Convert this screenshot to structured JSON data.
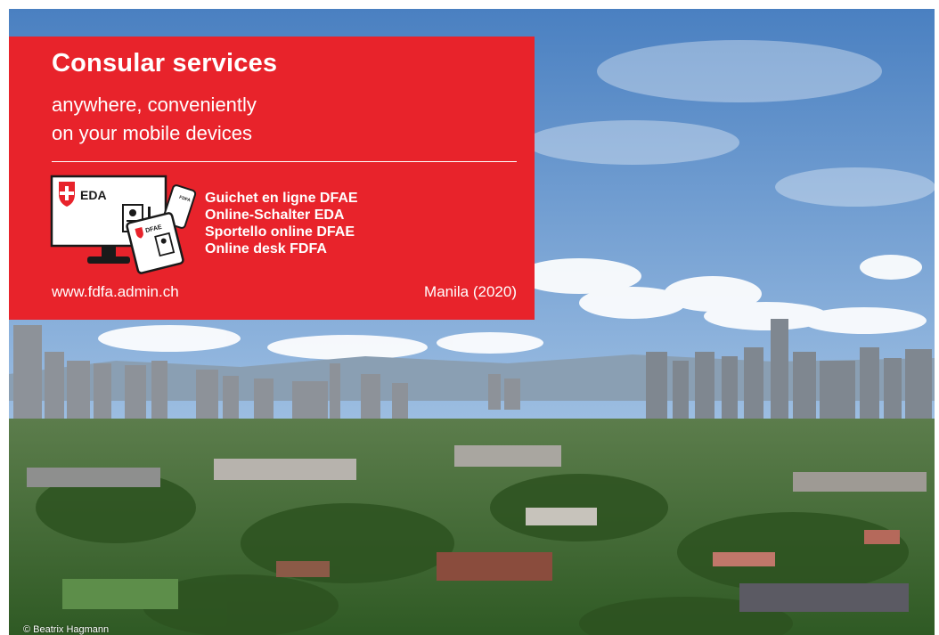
{
  "header": {
    "title": "Consular services",
    "subtitle_line1": "anywhere, conveniently",
    "subtitle_line2": "on your mobile devices"
  },
  "graphic": {
    "monitor_label": "EDA",
    "card_label": "DFAE",
    "phone_label": "FDFA",
    "icons": [
      "swiss-cross-icon",
      "id-card-icon",
      "monitor-icon",
      "tablet-icon",
      "phone-icon"
    ]
  },
  "online_desk": {
    "items": [
      "Guichet en ligne DFAE",
      "Online-Schalter EDA",
      "Sportello online DFAE",
      "Online desk FDFA"
    ]
  },
  "footer": {
    "website": "www.fdfa.admin.ch",
    "location": "Manila (2020)"
  },
  "photo": {
    "credit": "© Beatrix Hagmann"
  },
  "colors": {
    "brand_red": "#e8232b",
    "text_on_red": "#ffffff",
    "sky_top": "#4f86c6",
    "sky_bottom": "#b8d2ea",
    "foliage": "#3f6a2c"
  }
}
